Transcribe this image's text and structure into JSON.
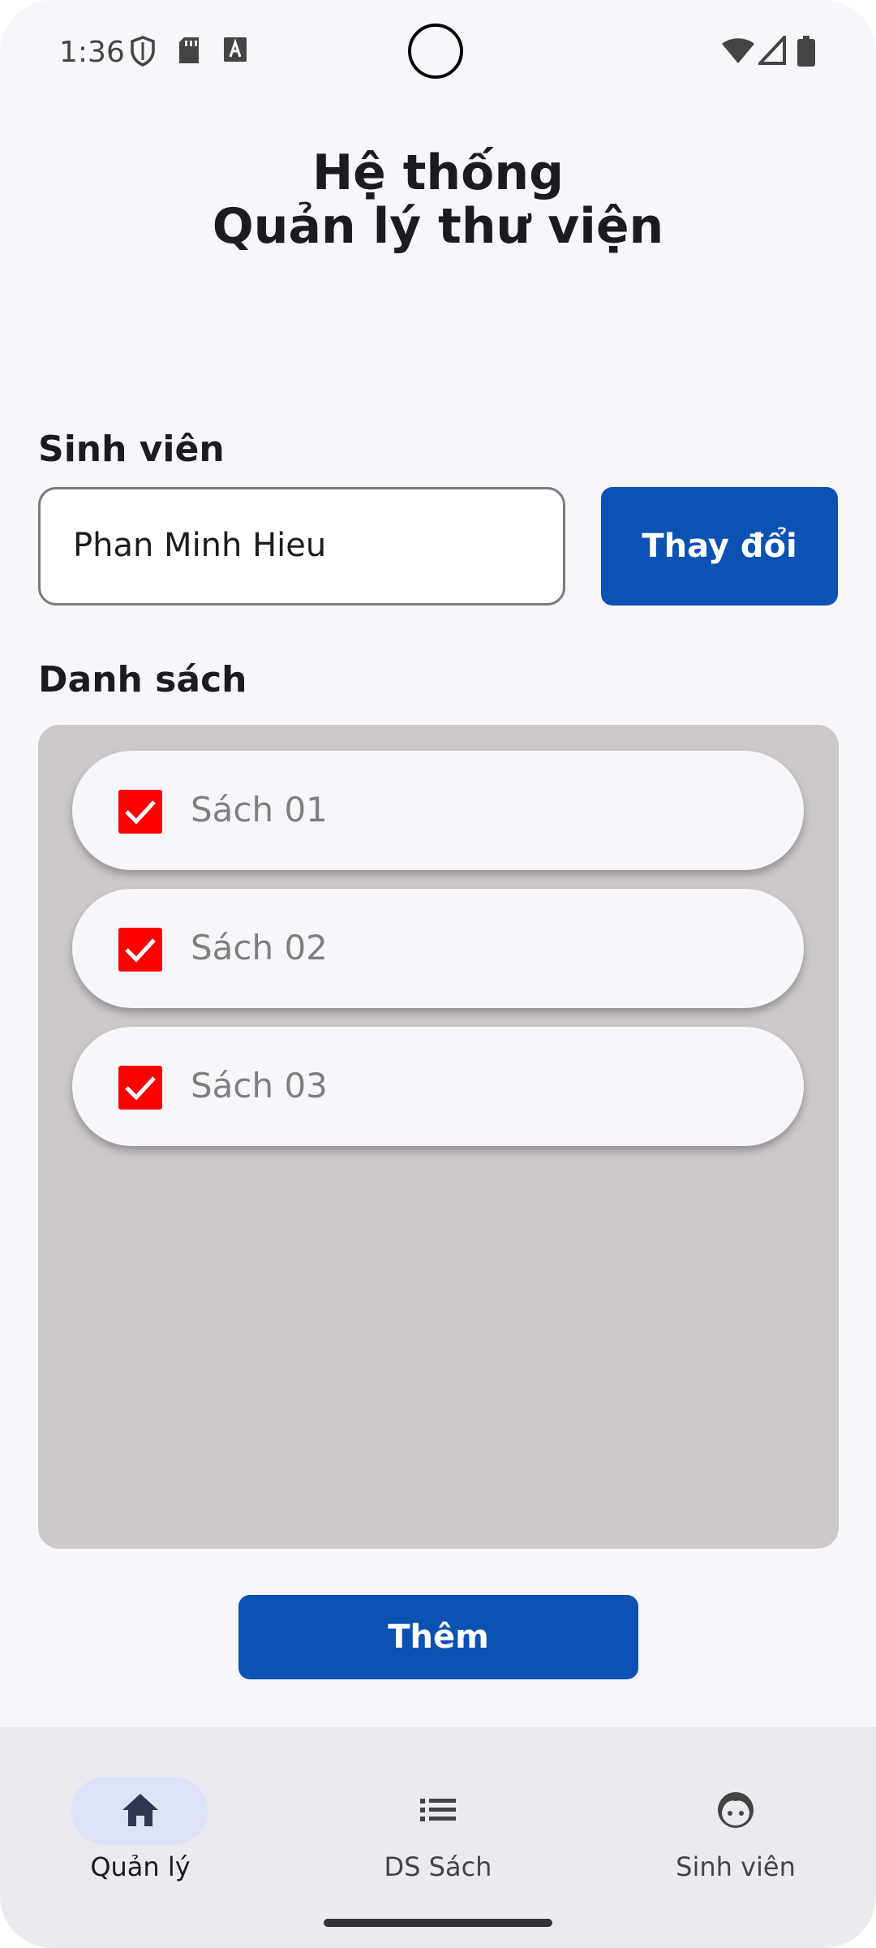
{
  "status_bar": {
    "time": "1:36",
    "icons": [
      "shield-icon",
      "sd-card-icon",
      "keyboard-a-icon",
      "wifi-icon",
      "signal-icon",
      "battery-icon"
    ]
  },
  "header": {
    "title_line1": "Hệ thống",
    "title_line2": "Quản lý thư viện"
  },
  "student": {
    "label": "Sinh viên",
    "name_value": "Phan Minh Hieu",
    "change_button": "Thay đổi"
  },
  "books": {
    "label": "Danh sách",
    "items": [
      {
        "title": "Sách 01",
        "checked": true
      },
      {
        "title": "Sách 02",
        "checked": true
      },
      {
        "title": "Sách 03",
        "checked": true
      }
    ]
  },
  "actions": {
    "add_button": "Thêm"
  },
  "bottom_nav": {
    "items": [
      {
        "label": "Quản lý",
        "icon": "home-icon",
        "active": true
      },
      {
        "label": "DS Sách",
        "icon": "list-icon",
        "active": false
      },
      {
        "label": "Sinh viên",
        "icon": "face-icon",
        "active": false
      }
    ]
  },
  "colors": {
    "primary": "#0b52b2",
    "checkbox": "#ff0000",
    "panel": "#cdc9c9",
    "background": "#f7f6fb"
  }
}
